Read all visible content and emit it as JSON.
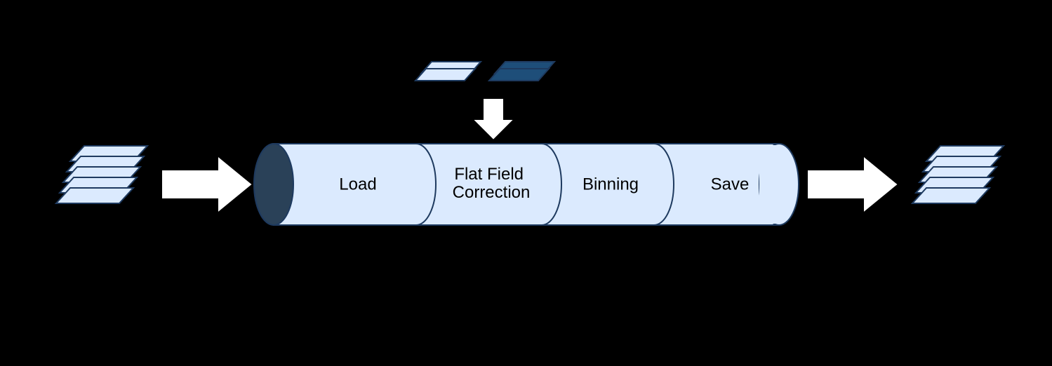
{
  "pipeline": {
    "stages": [
      {
        "label": "Load"
      },
      {
        "label": "Flat Field Correction"
      },
      {
        "label": "Binning"
      },
      {
        "label": "Save"
      }
    ]
  },
  "colors": {
    "pipe_fill": "#dbeafe",
    "pipe_stroke": "#1e3a5f",
    "pipe_cap_dark": "#2a4158",
    "stack_light_fill": "#dbeafe",
    "stack_dark_fill": "#1e4e79",
    "stack_stroke": "#1e3a5f",
    "arrow_fill": "#ffffff",
    "arrow_stroke": "#000000"
  }
}
